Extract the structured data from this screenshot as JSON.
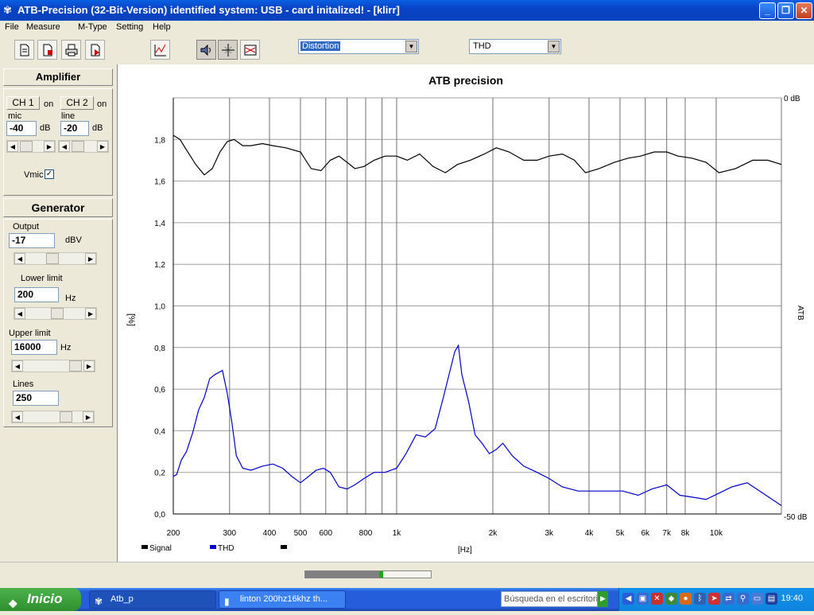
{
  "window": {
    "title": "ATB-Precision  (32-Bit-Version)  identified system: USB - card  initalized! - [klirr]"
  },
  "menu": [
    "File",
    "Measure",
    "M-Type",
    "Setting",
    "Help"
  ],
  "toolbar": {
    "measure_combo": "Distortion",
    "display_combo": "THD"
  },
  "amplifier": {
    "heading": "Amplifier",
    "ch1": {
      "label": "CH 1",
      "state": "on",
      "input": "mic",
      "gain": "-40",
      "unit": "dB"
    },
    "ch2": {
      "label": "CH 2",
      "state": "on",
      "input": "line",
      "gain": "-20",
      "unit": "dB"
    },
    "vmic_label": "Vmic",
    "vmic_checked": true,
    "check_mark": "✓"
  },
  "generator": {
    "heading": "Generator",
    "output_label": "Output",
    "output_value": "-17",
    "output_unit": "dBV",
    "lower_label": "Lower limit",
    "lower_value": "200",
    "lower_unit": "Hz",
    "upper_label": "Upper limit",
    "upper_value": "16000",
    "upper_unit": "Hz",
    "lines_label": "Lines",
    "lines_value": "250"
  },
  "chart_data": {
    "type": "line",
    "title": "ATB precision",
    "ylabel": "[%]",
    "xlabel": "[Hz]",
    "y2label": "ATB",
    "x_scale": "log",
    "xlim": [
      200,
      16000
    ],
    "ylim": [
      0,
      2.0
    ],
    "y_ticks": [
      "0,0",
      "0,2",
      "0,4",
      "0,6",
      "0,8",
      "1,0",
      "1,2",
      "1,4",
      "1,6",
      "1,8"
    ],
    "x_ticks": [
      {
        "value": 200,
        "label": "200"
      },
      {
        "value": 300,
        "label": "300"
      },
      {
        "value": 400,
        "label": "400"
      },
      {
        "value": 500,
        "label": "500"
      },
      {
        "value": 600,
        "label": "600"
      },
      {
        "value": 800,
        "label": "800"
      },
      {
        "value": 1000,
        "label": "1k"
      },
      {
        "value": 2000,
        "label": "2k"
      },
      {
        "value": 3000,
        "label": "3k"
      },
      {
        "value": 4000,
        "label": "4k"
      },
      {
        "value": 5000,
        "label": "5k"
      },
      {
        "value": 6000,
        "label": "6k"
      },
      {
        "value": 7000,
        "label": "7k"
      },
      {
        "value": 8000,
        "label": "8k"
      },
      {
        "value": 10000,
        "label": "10k"
      }
    ],
    "minor_x_gridlines": [
      700,
      900
    ],
    "right_axis_labels": {
      "top": "0 dB",
      "bottom": "-50 dB"
    },
    "grid": true,
    "legend_position": "bottom-left",
    "series": [
      {
        "name": "Signal",
        "color": "#000000",
        "x": [
          200,
          210,
          220,
          235,
          250,
          265,
          280,
          295,
          310,
          330,
          350,
          380,
          410,
          450,
          500,
          540,
          580,
          620,
          660,
          700,
          740,
          790,
          850,
          920,
          1000,
          1080,
          1180,
          1300,
          1420,
          1550,
          1700,
          1880,
          2050,
          2250,
          2500,
          2750,
          3000,
          3300,
          3600,
          3900,
          4300,
          4800,
          5300,
          5800,
          6400,
          7000,
          7600,
          8400,
          9300,
          10200,
          11500,
          13000,
          14500,
          16000
        ],
        "values": [
          1.82,
          1.8,
          1.75,
          1.68,
          1.63,
          1.66,
          1.74,
          1.79,
          1.8,
          1.77,
          1.77,
          1.78,
          1.77,
          1.76,
          1.74,
          1.66,
          1.65,
          1.7,
          1.72,
          1.69,
          1.66,
          1.67,
          1.7,
          1.72,
          1.72,
          1.7,
          1.73,
          1.67,
          1.64,
          1.68,
          1.7,
          1.73,
          1.76,
          1.74,
          1.7,
          1.7,
          1.72,
          1.73,
          1.7,
          1.64,
          1.66,
          1.69,
          1.71,
          1.72,
          1.74,
          1.74,
          1.72,
          1.71,
          1.69,
          1.64,
          1.66,
          1.7,
          1.7,
          1.68
        ]
      },
      {
        "name": "THD",
        "color": "#0000c8",
        "x": [
          200,
          205,
          212,
          220,
          230,
          240,
          250,
          260,
          270,
          285,
          295,
          305,
          315,
          330,
          350,
          380,
          410,
          440,
          470,
          500,
          530,
          560,
          590,
          620,
          660,
          700,
          740,
          790,
          850,
          920,
          1000,
          1070,
          1150,
          1230,
          1320,
          1400,
          1470,
          1520,
          1560,
          1600,
          1680,
          1760,
          1850,
          1950,
          2050,
          2150,
          2300,
          2500,
          2750,
          3000,
          3300,
          3700,
          4100,
          4600,
          5100,
          5700,
          6300,
          7000,
          7700,
          8500,
          9300,
          10200,
          11200,
          12500,
          14000,
          16000
        ],
        "values": [
          0.18,
          0.19,
          0.26,
          0.3,
          0.39,
          0.5,
          0.56,
          0.65,
          0.67,
          0.69,
          0.58,
          0.44,
          0.28,
          0.22,
          0.21,
          0.23,
          0.24,
          0.22,
          0.18,
          0.15,
          0.18,
          0.21,
          0.22,
          0.2,
          0.13,
          0.12,
          0.14,
          0.17,
          0.2,
          0.2,
          0.22,
          0.29,
          0.38,
          0.37,
          0.41,
          0.56,
          0.69,
          0.78,
          0.81,
          0.67,
          0.54,
          0.38,
          0.34,
          0.29,
          0.31,
          0.34,
          0.28,
          0.23,
          0.2,
          0.17,
          0.13,
          0.11,
          0.11,
          0.11,
          0.11,
          0.09,
          0.12,
          0.14,
          0.09,
          0.08,
          0.07,
          0.1,
          0.13,
          0.15,
          0.1,
          0.04
        ]
      },
      {
        "name": "",
        "color": "#000000",
        "x": [],
        "values": []
      }
    ]
  },
  "progress": {
    "fraction": 0.62
  },
  "taskbar": {
    "start_label": "Inicio",
    "tasks": [
      "Atb_p",
      "linton 200hz16khz th..."
    ],
    "search_placeholder": "Búsqueda en el escritorio",
    "clock": "19:40"
  }
}
